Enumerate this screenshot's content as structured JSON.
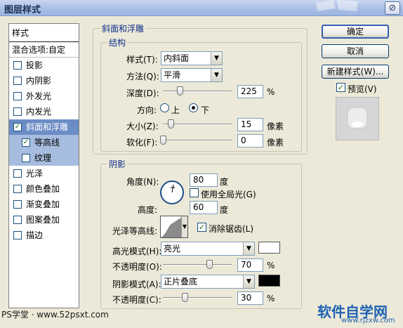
{
  "window": {
    "title": "图层样式",
    "close_label": "⊘"
  },
  "styles": {
    "header": "样式",
    "blend_options": "混合选项:自定",
    "items": [
      {
        "label": "投影",
        "checked": false
      },
      {
        "label": "内阴影",
        "checked": false
      },
      {
        "label": "外发光",
        "checked": false
      },
      {
        "label": "内发光",
        "checked": false
      },
      {
        "label": "斜面和浮雕",
        "checked": true
      },
      {
        "label": "等高线",
        "checked": true
      },
      {
        "label": "纹理",
        "checked": false
      },
      {
        "label": "光泽",
        "checked": false
      },
      {
        "label": "颜色叠加",
        "checked": false
      },
      {
        "label": "渐变叠加",
        "checked": false
      },
      {
        "label": "图案叠加",
        "checked": false
      },
      {
        "label": "描边",
        "checked": false
      }
    ]
  },
  "bevel": {
    "section_title": "斜面和浮雕",
    "structure_title": "结构",
    "style_label": "样式(T):",
    "style_value": "内斜面",
    "technique_label": "方法(Q):",
    "technique_value": "平滑",
    "depth_label": "深度(D):",
    "depth_value": "225",
    "depth_unit": "%",
    "depth_slider_fraction": 0.22,
    "direction_label": "方向:",
    "direction_up": "上",
    "direction_down": "下",
    "direction_selected": "下",
    "size_label": "大小(Z):",
    "size_value": "15",
    "size_unit": "像素",
    "size_slider_fraction": 0.08,
    "soften_label": "软化(F):",
    "soften_value": "0",
    "soften_unit": "像素",
    "soften_slider_fraction": 0.0
  },
  "shading": {
    "title": "阴影",
    "angle_label": "角度(N):",
    "angle_value": "80",
    "angle_unit": "度",
    "global_light_label": "使用全局光(G)",
    "global_light_checked": false,
    "altitude_label": "高度:",
    "altitude_value": "60",
    "altitude_unit": "度",
    "gloss_contour_label": "光泽等高线:",
    "anti_aliased_label": "消除锯齿(L)",
    "anti_aliased_checked": true,
    "highlight_mode_label": "高光模式(H):",
    "highlight_mode_value": "亮光",
    "highlight_color": "#ffffff",
    "highlight_opacity_label": "不透明度(O):",
    "highlight_opacity_value": "70",
    "highlight_opacity_unit": "%",
    "highlight_opacity_fraction": 0.7,
    "shadow_mode_label": "阴影模式(A):",
    "shadow_mode_value": "正片叠底",
    "shadow_color": "#000000",
    "shadow_opacity_label": "不透明度(C):",
    "shadow_opacity_value": "30",
    "shadow_opacity_unit": "%",
    "shadow_opacity_fraction": 0.3
  },
  "buttons": {
    "ok": "确定",
    "cancel": "取消",
    "new_style": "新建样式(W)...",
    "preview_label": "预览(V)",
    "preview_checked": true
  },
  "watermark": {
    "left": "PS学堂 · www.52psxt.com",
    "right": "软件自学网",
    "right_url": "www.rjzxw.com"
  }
}
